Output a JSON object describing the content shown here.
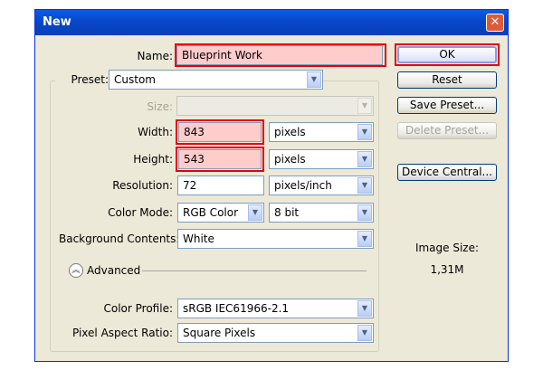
{
  "window": {
    "title": "New",
    "close_icon": "close-icon"
  },
  "labels": {
    "name": "Name:",
    "preset": "Preset:",
    "size": "Size:",
    "width": "Width:",
    "height": "Height:",
    "resolution": "Resolution:",
    "color_mode": "Color Mode:",
    "background": "Background Contents:",
    "advanced": "Advanced",
    "color_profile": "Color Profile:",
    "pixel_aspect": "Pixel Aspect Ratio:"
  },
  "fields": {
    "name": "Blueprint Work",
    "preset": "Custom",
    "size": "",
    "width": "843",
    "width_unit": "pixels",
    "height": "543",
    "height_unit": "pixels",
    "resolution": "72",
    "resolution_unit": "pixels/inch",
    "color_mode": "RGB Color",
    "bit_depth": "8 bit",
    "background": "White",
    "color_profile": "sRGB IEC61966-2.1",
    "pixel_aspect": "Square Pixels"
  },
  "buttons": {
    "ok": "OK",
    "reset": "Reset",
    "save_preset": "Save Preset...",
    "delete_preset": "Delete Preset...",
    "device_central": "Device Central..."
  },
  "image_size": {
    "label": "Image Size:",
    "value": "1,31M"
  },
  "colors": {
    "highlight": "#E30010",
    "titlebar": "#0A5BE8",
    "dialog_bg": "#ECE9D8"
  }
}
